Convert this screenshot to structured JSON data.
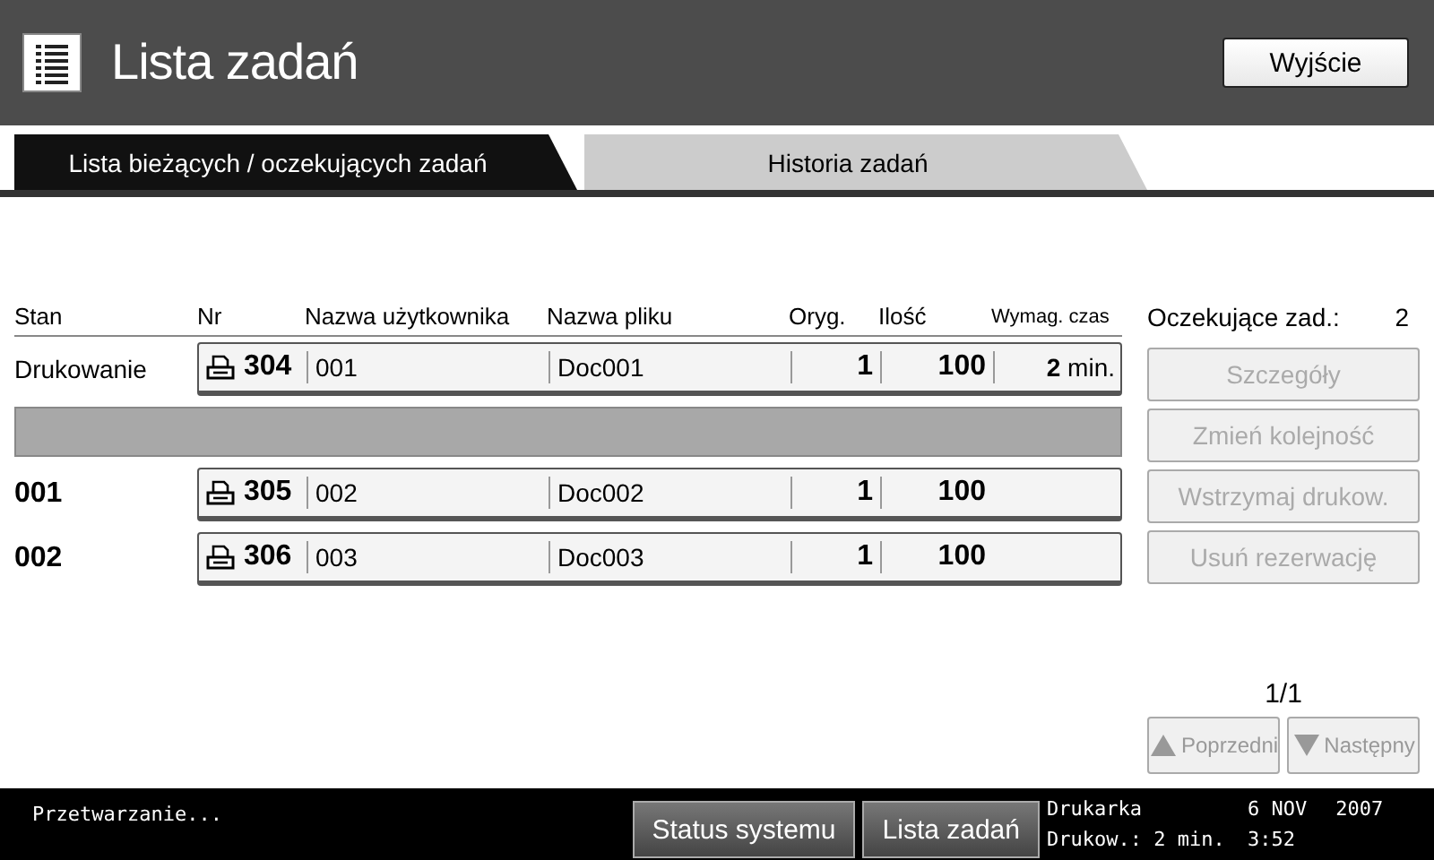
{
  "header": {
    "title": "Lista zadań",
    "exit_button": "Wyjście"
  },
  "tabs": [
    {
      "label": "Lista bieżących / oczekujących zadań",
      "selected": true
    },
    {
      "label": "Historia zadań",
      "selected": false
    }
  ],
  "columns": [
    "Stan",
    "Nr",
    "Nazwa użytkownika",
    "Nazwa pliku",
    "Oryg.",
    "Ilość",
    "Wymag. czas"
  ],
  "rows": [
    {
      "kind": "job",
      "status": "Drukowanie",
      "status_bold": false,
      "nr": "304",
      "user": "001",
      "file": "Doc001",
      "originals": "1",
      "quantity": "100",
      "time": "**2** min."
    },
    {
      "kind": "empty"
    },
    {
      "kind": "job",
      "status": "001",
      "status_bold": true,
      "nr": "305",
      "user": "002",
      "file": "Doc002",
      "originals": "1",
      "quantity": "100"
    },
    {
      "kind": "job",
      "status": "002",
      "status_bold": true,
      "nr": "306",
      "user": "003",
      "file": "Doc003",
      "originals": "1",
      "quantity": "100"
    }
  ],
  "waiting": {
    "label": "Oczekujące zad.:",
    "count": "2"
  },
  "actions": [
    {
      "label": "Szczegóły",
      "disabled": true
    },
    {
      "label": "Zmień kolejność",
      "disabled": true
    },
    {
      "label": "Wstrzymaj drukow.",
      "disabled": true
    },
    {
      "label": "Usuń rezerwację",
      "disabled": true
    }
  ],
  "pager": {
    "page": "1/1",
    "previous": {
      "label": "Poprzedni",
      "disabled": true
    },
    "next": {
      "label": "Następny",
      "disabled": true
    }
  },
  "status_bar": {
    "message": "Przetwarzanie...",
    "buttons": [
      "Status systemu",
      "Lista zadań"
    ],
    "printer_label": "Drukarka",
    "printer_time": "Drukow.: 2 min.",
    "date": "6 NOV",
    "year": "2007",
    "clock": "3:52"
  }
}
